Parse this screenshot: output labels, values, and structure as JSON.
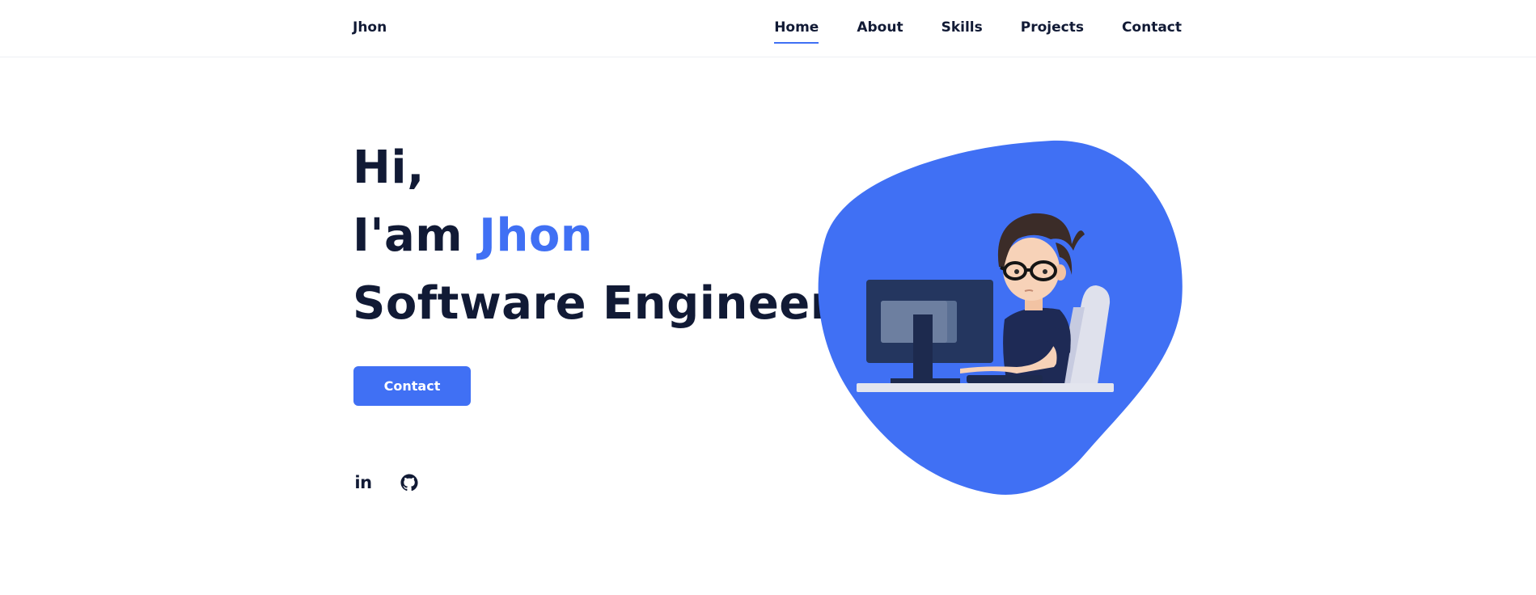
{
  "brand": "Jhon",
  "nav": [
    {
      "label": "Home",
      "active": true
    },
    {
      "label": "About",
      "active": false
    },
    {
      "label": "Skills",
      "active": false
    },
    {
      "label": "Projects",
      "active": false
    },
    {
      "label": "Contact",
      "active": false
    }
  ],
  "hero": {
    "line1": "Hi,",
    "line2_prefix": "I'am ",
    "name": "Jhon",
    "line3": "Software Engineer",
    "cta_label": "Contact"
  },
  "socials": [
    {
      "icon": "linkedin-icon",
      "label": "in"
    },
    {
      "icon": "github-icon"
    }
  ],
  "colors": {
    "accent": "#4070f4",
    "text": "#111a35"
  }
}
